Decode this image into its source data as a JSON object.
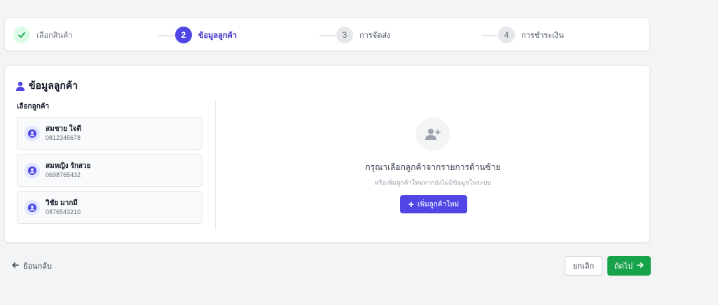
{
  "stepper": {
    "steps": [
      {
        "number": "✓",
        "label": "เลือกสินค้า",
        "state": "done"
      },
      {
        "number": "2",
        "label": "ข้อมูลลูกค้า",
        "state": "active"
      },
      {
        "number": "3",
        "label": "การจัดส่ง",
        "state": "pending"
      },
      {
        "number": "4",
        "label": "การชำระเงิน",
        "state": "pending"
      }
    ]
  },
  "customer_section": {
    "title": "ข้อมูลลูกค้า",
    "select_label": "เลือกลูกค้า",
    "customers": [
      {
        "name": "สมชาย ใจดี",
        "phone": "0812345678"
      },
      {
        "name": "สมหญิง รักสวย",
        "phone": "0698765432"
      },
      {
        "name": "วิชัย มากมี",
        "phone": "0876543210"
      }
    ]
  },
  "empty_state": {
    "title": "กรุณาเลือกลูกค้าจากรายการด้านซ้าย",
    "subtitle": "หรือเพิ่มลูกค้าใหม่หากยังไม่มีข้อมูลในระบบ",
    "add_button": "เพิ่มลูกค้าใหม่"
  },
  "footer": {
    "back_label": "ย้อนกลับ",
    "cancel_label": "ยกเลิก",
    "next_label": "ถัดไป"
  },
  "colors": {
    "primary": "#4f46e5",
    "success": "#16a34a",
    "done_bg": "#dcfce7"
  }
}
